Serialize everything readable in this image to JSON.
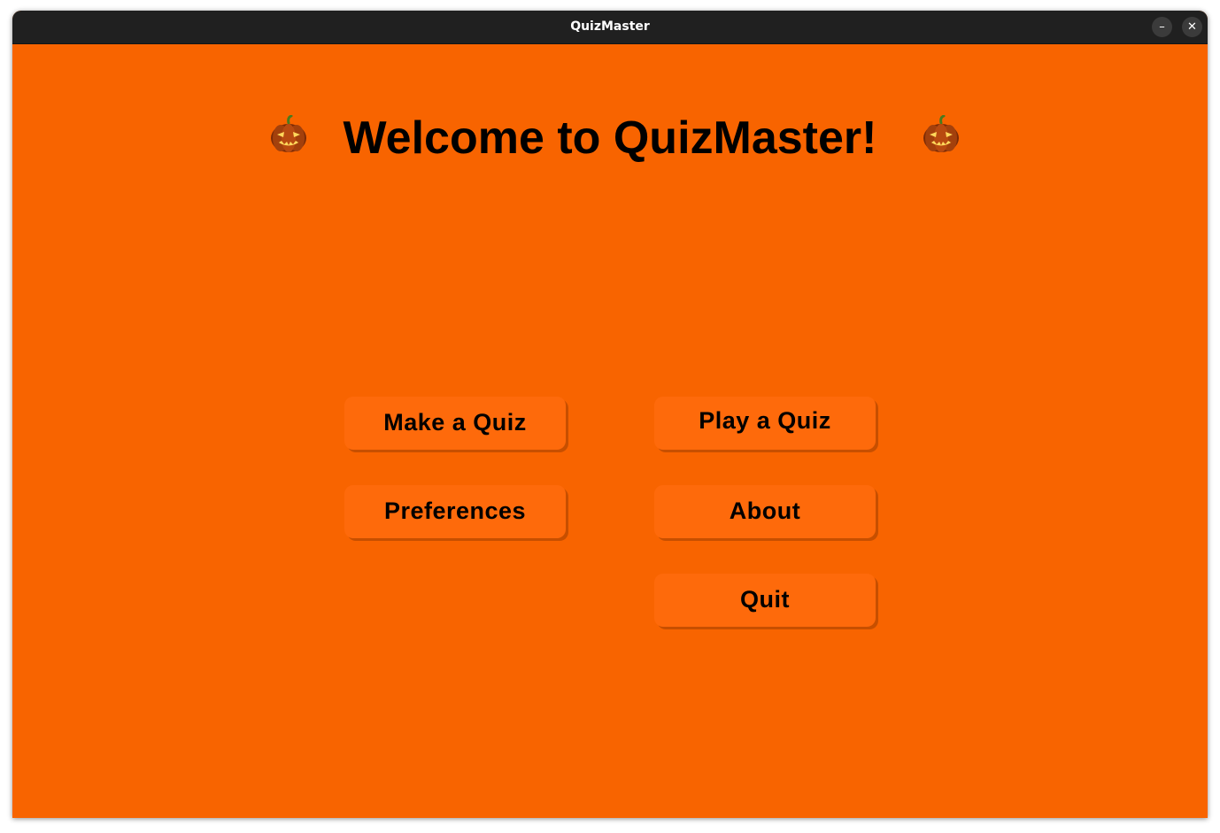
{
  "window": {
    "title": "QuizMaster",
    "minimize_label": "–",
    "close_label": "✕"
  },
  "main": {
    "heading": "Welcome to QuizMaster!",
    "decor_icon": "jack-o-lantern-icon",
    "buttons": {
      "make_quiz": "Make a Quiz",
      "play_quiz": "Play a Quiz",
      "preferences": "Preferences",
      "about": "About",
      "quit": "Quit"
    }
  },
  "colors": {
    "background": "#f86400",
    "button": "#fe6a0b",
    "button_shadow": "#c74f00",
    "titlebar": "#202020"
  }
}
